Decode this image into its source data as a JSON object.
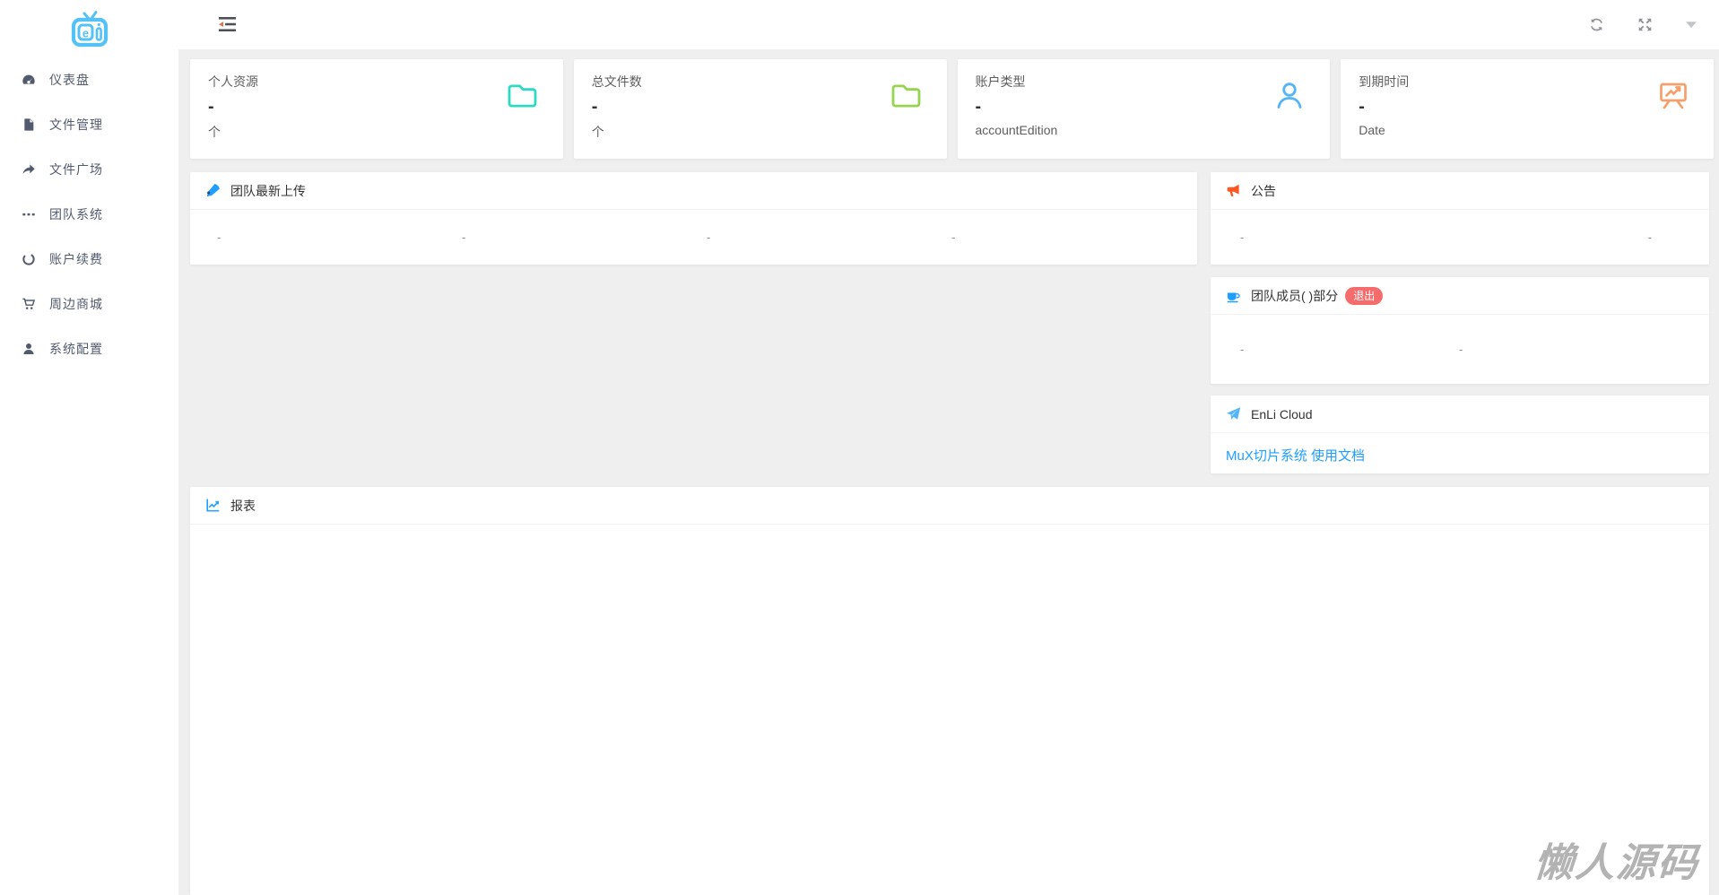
{
  "topbar": {
    "collapse_icon": "outdent-icon",
    "refresh_icon": "refresh-icon",
    "fullscreen_icon": "fullscreen-icon",
    "dropdown_icon": "caret-down-icon"
  },
  "sidebar": {
    "logo_icon": "tv-logo-icon",
    "items": [
      {
        "label": "仪表盘",
        "icon": "dashboard-gauge-icon"
      },
      {
        "label": "文件管理",
        "icon": "file-icon"
      },
      {
        "label": "文件广场",
        "icon": "share-arrow-icon"
      },
      {
        "label": "团队系统",
        "icon": "ellipsis-icon"
      },
      {
        "label": "账户续费",
        "icon": "circle-notch-icon"
      },
      {
        "label": "周边商城",
        "icon": "shopping-cart-icon"
      },
      {
        "label": "系统配置",
        "icon": "user-icon"
      }
    ]
  },
  "stats": {
    "cards": [
      {
        "title": "个人资源",
        "value": "-",
        "sub": "个",
        "icon": "folder-icon",
        "color": "#2ed9c3"
      },
      {
        "title": "总文件数",
        "value": "-",
        "sub": "个",
        "icon": "folder-icon",
        "color": "#95d44e"
      },
      {
        "title": "账户类型",
        "value": "-",
        "sub": "accountEdition",
        "icon": "person-icon",
        "color": "#54b4f8"
      },
      {
        "title": "到期时间",
        "value": "-",
        "sub": "Date",
        "icon": "presentation-chart-icon",
        "color": "#f5a06b"
      }
    ]
  },
  "panels": {
    "team_uploads": {
      "title": "团队最新上传",
      "icon": "pen-icon",
      "icon_color": "#1e9fff",
      "placeholders": [
        "-",
        "-",
        "-",
        "-"
      ]
    },
    "announcement": {
      "title": "公告",
      "icon": "megaphone-icon",
      "icon_color": "#ff5722",
      "placeholders": [
        "-",
        "-"
      ]
    },
    "team_members": {
      "title": "团队成员( )部分",
      "icon": "cup-icon",
      "icon_color": "#1e9fff",
      "badge": "退出",
      "badge_color": "#f56c6c",
      "placeholders": [
        "-",
        "-"
      ]
    },
    "enli_cloud": {
      "title": "EnLi Cloud",
      "icon": "paper-plane-icon",
      "icon_color": "#54b4f8",
      "link_text": "MuX切片系统 使用文档",
      "link_color": "#1e9fff"
    },
    "report": {
      "title": "报表",
      "icon": "chart-line-icon",
      "icon_color": "#1e9fff"
    }
  },
  "watermark": "懒人源码",
  "colors": {
    "logo_blue": "#55c2f7",
    "accent_blue": "#1e9fff",
    "sidebar_text": "#515a6e",
    "content_background": "#efefef"
  }
}
